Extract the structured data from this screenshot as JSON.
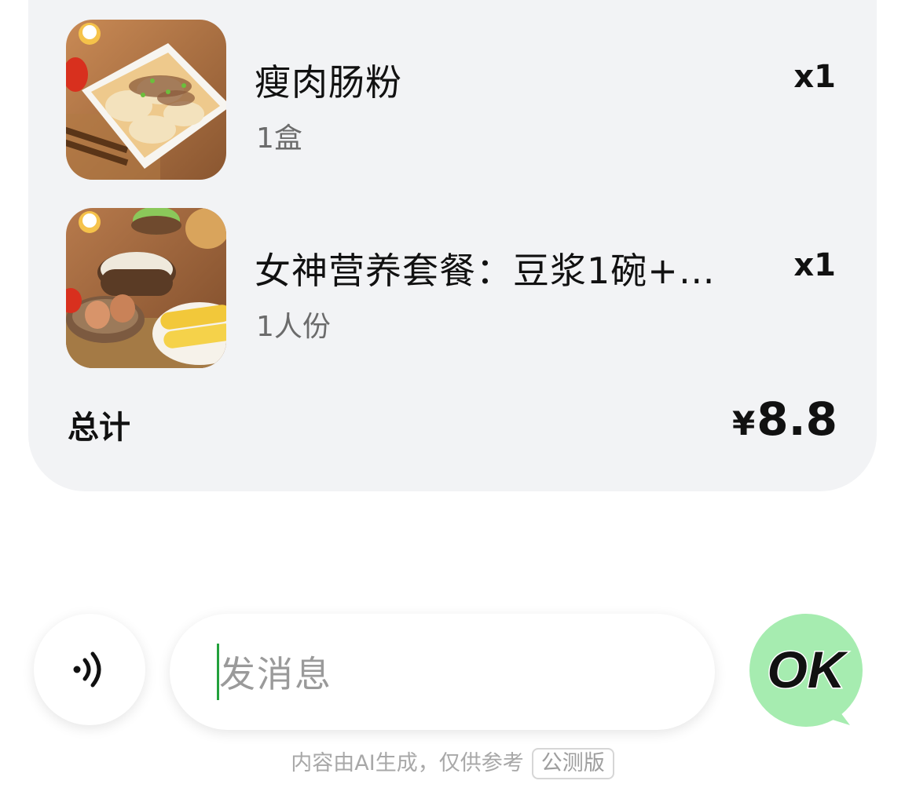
{
  "order": {
    "items": [
      {
        "name": "瘦肉肠粉",
        "spec": "1盒",
        "qty": "x1",
        "thumb_icon": "rice-noodle-roll-photo"
      },
      {
        "name": "女神营养套餐：豆浆1碗+…",
        "spec": "1人份",
        "qty": "x1",
        "thumb_icon": "soy-milk-set-photo"
      }
    ],
    "total_label": "总计",
    "total_currency": "¥",
    "total_value": "8.8"
  },
  "composer": {
    "placeholder": "发消息",
    "voice_icon": "voice-wave-icon",
    "ok_label": "OK"
  },
  "footer": {
    "disclaimer": "内容由AI生成，仅供参考",
    "badge": "公测版"
  },
  "colors": {
    "card_bg": "#f2f3f5",
    "ok_green": "#a6ecb0",
    "caret_green": "#23a13c"
  }
}
